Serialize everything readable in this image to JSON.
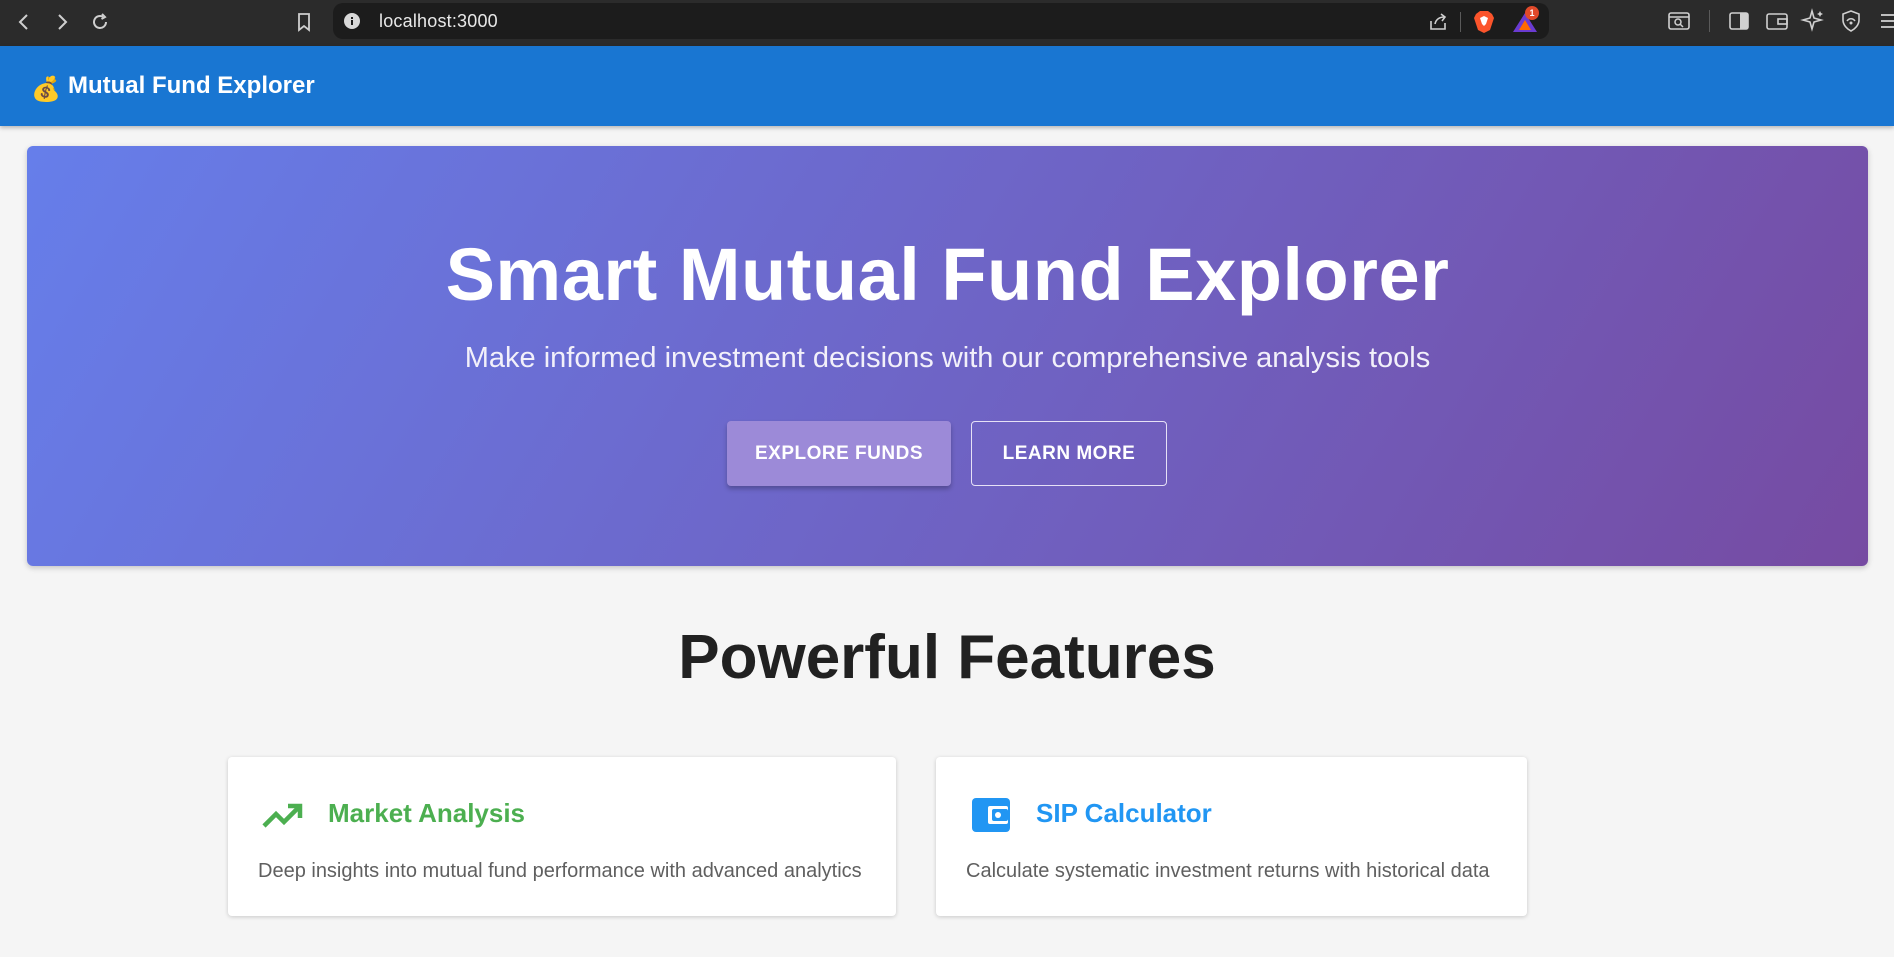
{
  "browser": {
    "url": "localhost:3000",
    "notification_count": "1"
  },
  "appbar": {
    "brand_emoji": "💰",
    "title": "Mutual Fund Explorer"
  },
  "hero": {
    "title": "Smart Mutual Fund Explorer",
    "subtitle": "Make informed investment decisions with our comprehensive analysis tools",
    "primary_button": "EXPLORE FUNDS",
    "secondary_button": "LEARN MORE"
  },
  "features": {
    "title": "Powerful Features",
    "cards": [
      {
        "title": "Market Analysis",
        "description": "Deep insights into mutual fund performance with advanced analytics",
        "icon": "trending-up-icon",
        "color": "#4caf50"
      },
      {
        "title": "SIP Calculator",
        "description": "Calculate systematic investment returns with historical data",
        "icon": "wallet-icon",
        "color": "#2196f3"
      }
    ]
  }
}
